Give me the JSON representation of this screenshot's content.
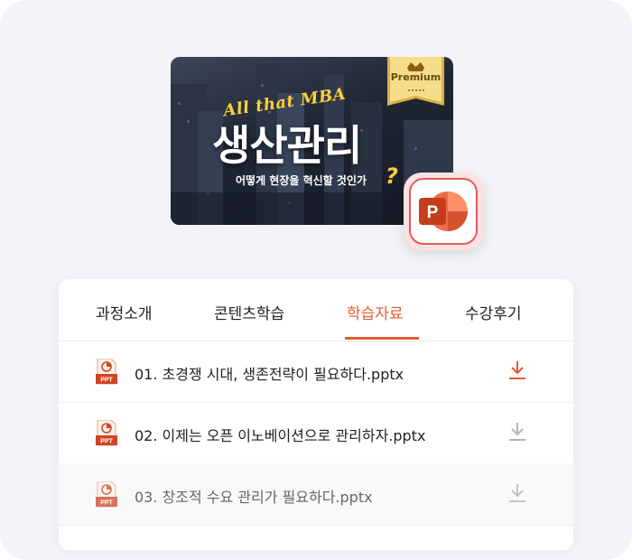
{
  "banner": {
    "english_title": "All that MBA",
    "title": "생산관리",
    "subtitle": "어떻게 현장을 혁신할 것인가",
    "question_mark": "?",
    "badge": "Premium"
  },
  "app_icon": {
    "letter": "P",
    "name": "powerpoint-icon"
  },
  "tabs": [
    {
      "label": "과정소개"
    },
    {
      "label": "콘텐츠학습"
    },
    {
      "label": "학습자료",
      "active": true
    },
    {
      "label": "수강후기"
    }
  ],
  "files": [
    {
      "name": "01. 초경쟁 시대, 생존전략이 필요하다.pptx",
      "icon_label": "PPT",
      "download_state": "active"
    },
    {
      "name": "02. 이제는 오픈 이노베이션으로 관리하자.pptx",
      "icon_label": "PPT",
      "download_state": "inactive"
    },
    {
      "name": "03. 창조적 수요 관리가 필요하다.pptx",
      "icon_label": "PPT",
      "download_state": "inactive"
    }
  ],
  "colors": {
    "accent": "#ea5a2f",
    "ppt_red": "#d04423",
    "download_inactive": "#b5b5b5",
    "background": "#f3f4f7"
  }
}
